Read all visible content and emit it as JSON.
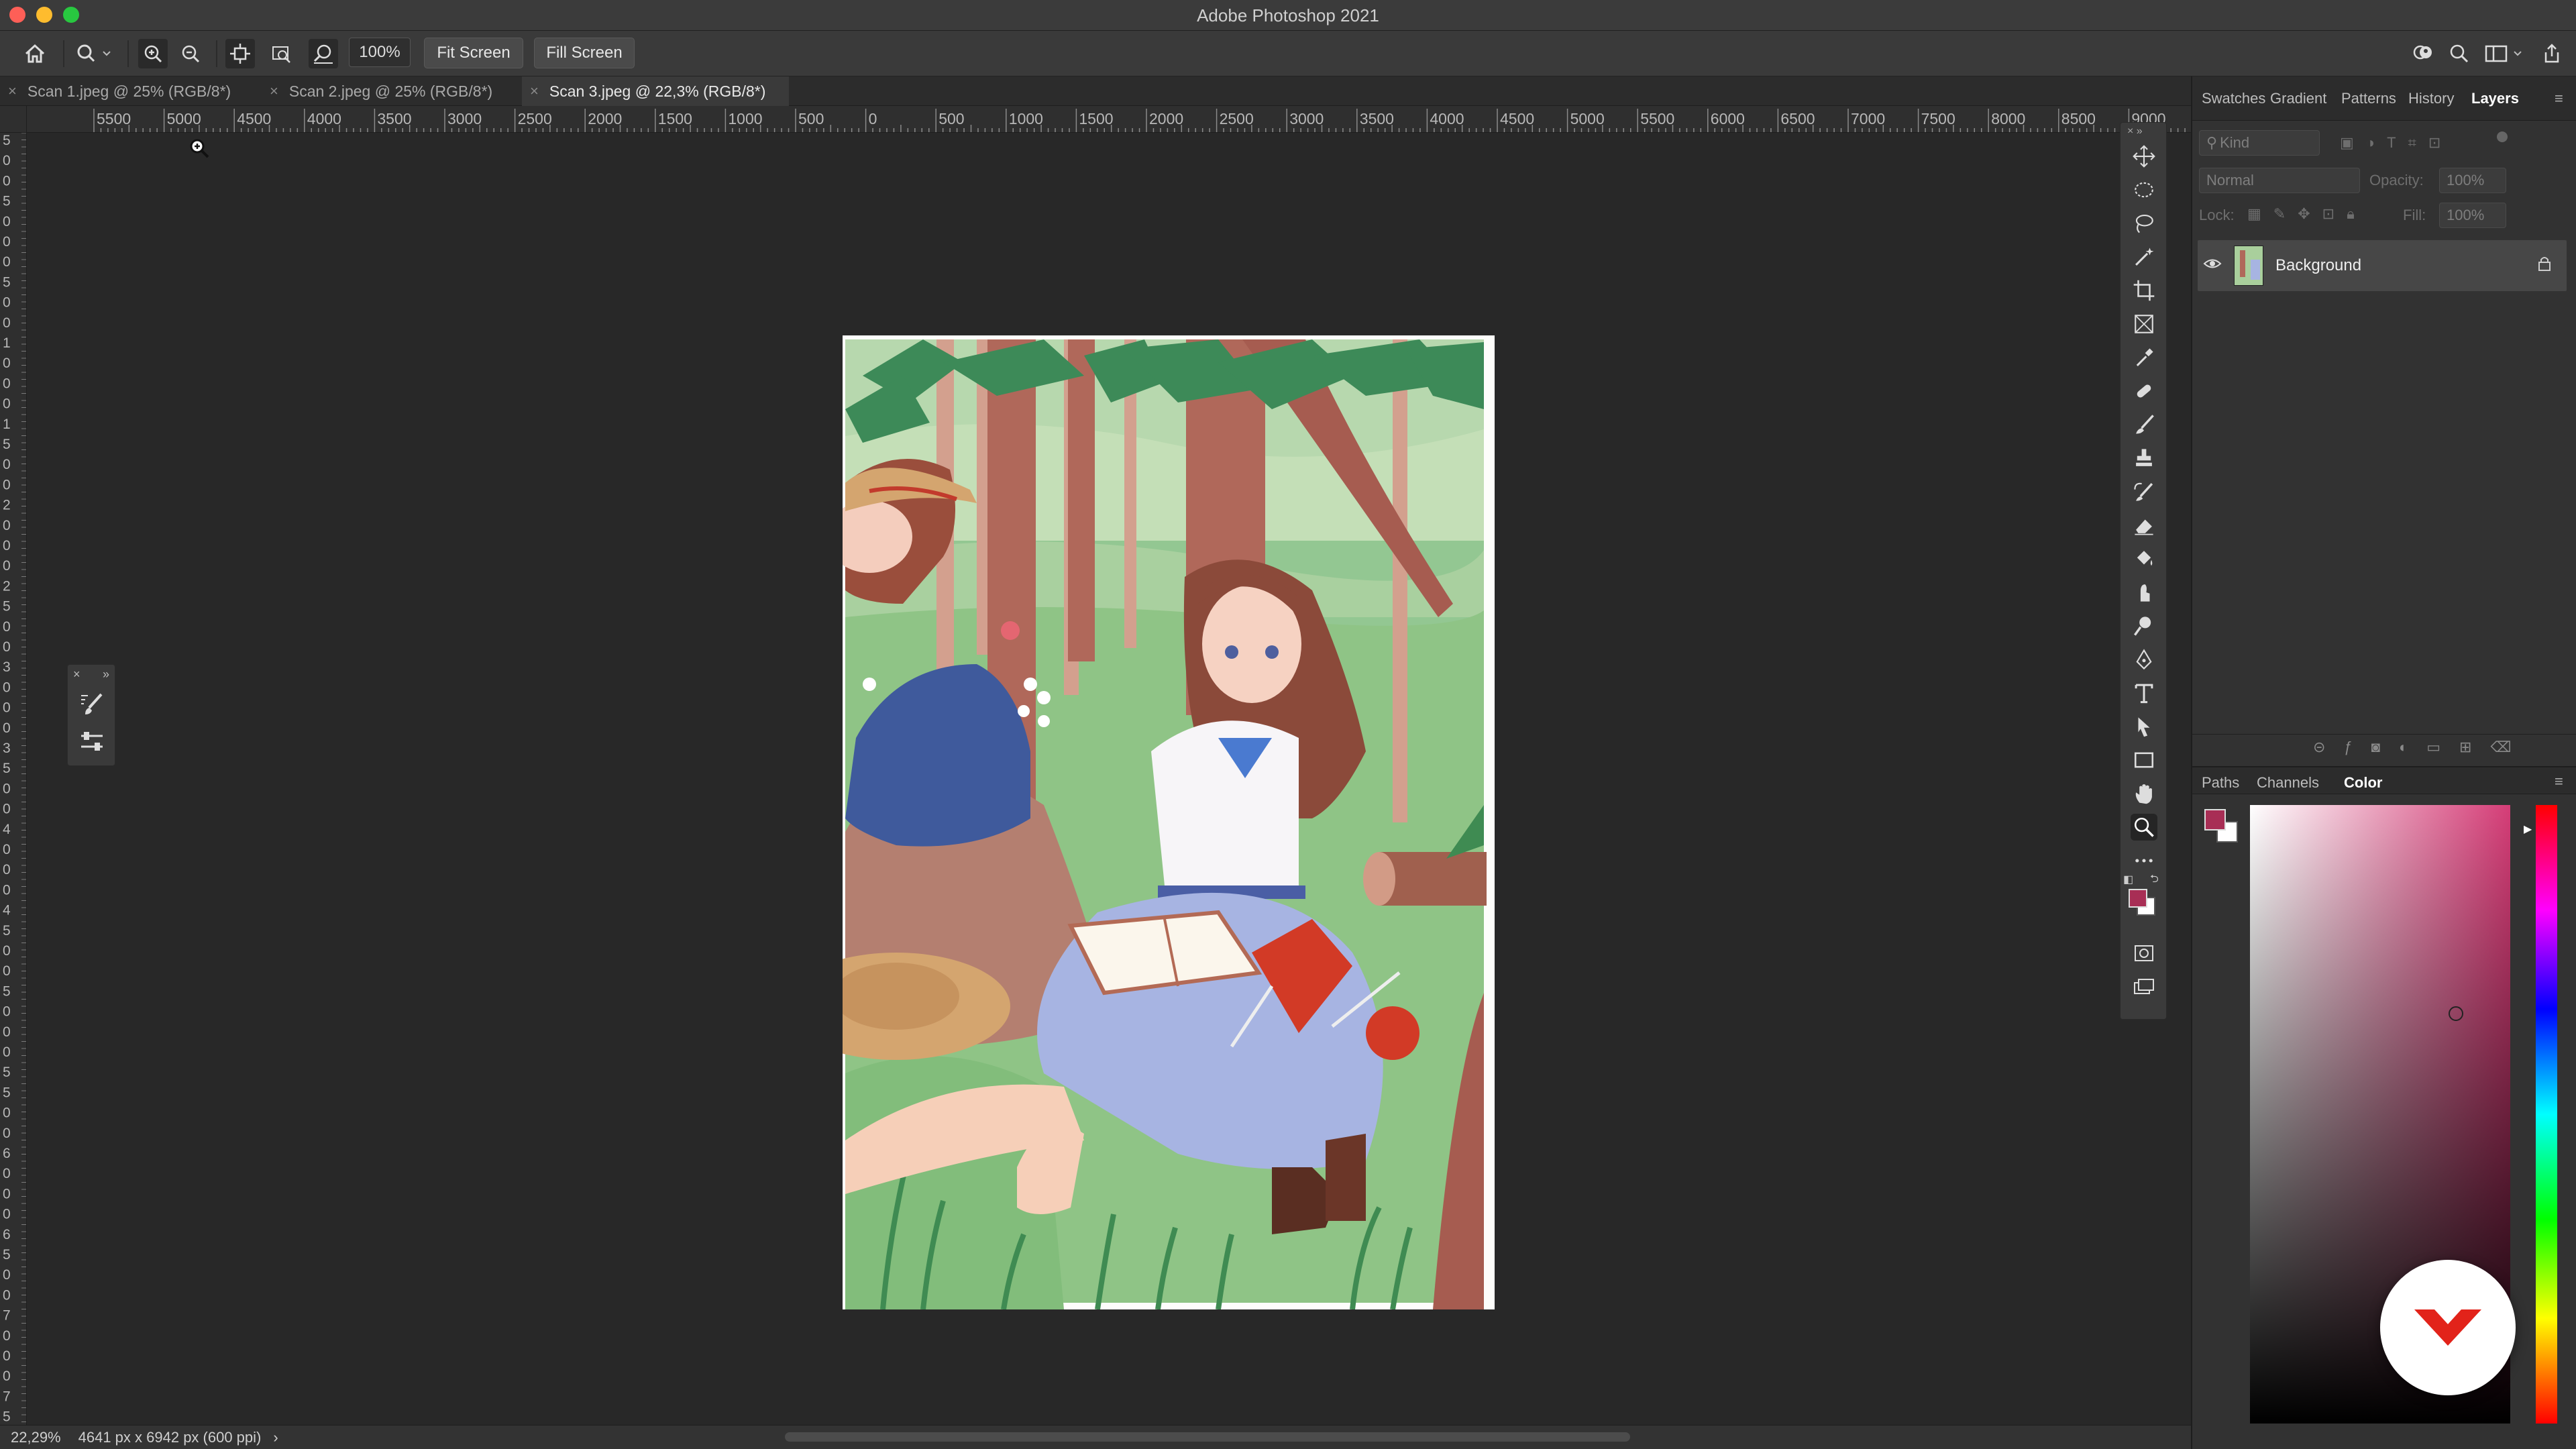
{
  "app": {
    "title": "Adobe Photoshop 2021"
  },
  "window_controls": {
    "close_color": "#fe5f57",
    "minimize_color": "#febc2e",
    "maximize_color": "#28c840"
  },
  "options_bar": {
    "zoom_value": "100%",
    "fit_screen_label": "Fit Screen",
    "fill_screen_label": "Fill Screen"
  },
  "tabs": [
    {
      "label": "Scan 1.jpeg @ 25% (RGB/8*)",
      "active": false
    },
    {
      "label": "Scan 2.jpeg @ 25% (RGB/8*)",
      "active": false
    },
    {
      "label": "Scan 3.jpeg @ 22,3% (RGB/8*)",
      "active": true
    }
  ],
  "ruler": {
    "h_labels": [
      "5500",
      "5000",
      "4500",
      "4000",
      "3500",
      "3000",
      "2500",
      "2000",
      "1500",
      "1000",
      "500",
      "0",
      "500",
      "1000",
      "1500",
      "2000",
      "2500",
      "3000",
      "3500",
      "4000",
      "4500",
      "5000",
      "5500",
      "6000",
      "6500",
      "7000",
      "7500",
      "8000",
      "8500",
      "9000"
    ],
    "v_labels": [
      "5",
      "0",
      "0",
      "5",
      "0",
      "0",
      "0",
      "5",
      "0",
      "0",
      "1",
      "0",
      "0",
      "0",
      "1",
      "5",
      "0",
      "0",
      "2",
      "0",
      "0",
      "0",
      "2",
      "5",
      "0",
      "0",
      "3",
      "0",
      "0",
      "0",
      "3",
      "5",
      "0",
      "0",
      "4",
      "0",
      "0",
      "0",
      "4",
      "5",
      "0",
      "0",
      "5",
      "0",
      "0",
      "0",
      "5",
      "5",
      "0",
      "0",
      "6",
      "0",
      "0",
      "0",
      "6",
      "5",
      "0",
      "0",
      "7",
      "0",
      "0",
      "0",
      "7",
      "5"
    ]
  },
  "status_bar": {
    "zoom": "22,29%",
    "doc_info": "4641 px x 6942 px (600 ppi)",
    "arrow": "›"
  },
  "panels_top": {
    "tabs": [
      "Swatches",
      "Gradient",
      "Patterns",
      "History",
      "Layers"
    ],
    "active_tab": "Layers",
    "filter_placeholder": "Kind",
    "blend_mode": "Normal",
    "opacity_label": "Opacity:",
    "opacity_value": "100%",
    "lock_label": "Lock:",
    "fill_label": "Fill:",
    "fill_value": "100%",
    "layers": [
      {
        "name": "Background",
        "visible": true,
        "locked": true
      }
    ]
  },
  "panels_bottom": {
    "tabs": [
      "Paths",
      "Channels",
      "Color"
    ],
    "active_tab": "Color",
    "foreground_color": "#a82e55",
    "background_color": "#ffffff",
    "color_field_hue": "#d53d77"
  },
  "tools": [
    "move-tool",
    "marquee-tool",
    "lasso-tool",
    "magic-wand-tool",
    "crop-tool",
    "frame-tool",
    "eyedropper-tool",
    "healing-brush-tool",
    "brush-tool",
    "clone-stamp-tool",
    "history-brush-tool",
    "eraser-tool",
    "paint-bucket-tool",
    "smudge-tool",
    "dodge-tool",
    "pen-tool",
    "type-tool",
    "path-selection-tool",
    "rectangle-tool",
    "hand-tool",
    "zoom-tool",
    "edit-toolbar"
  ],
  "active_tool": "zoom-tool",
  "badge": {
    "color": "#e2231a"
  }
}
